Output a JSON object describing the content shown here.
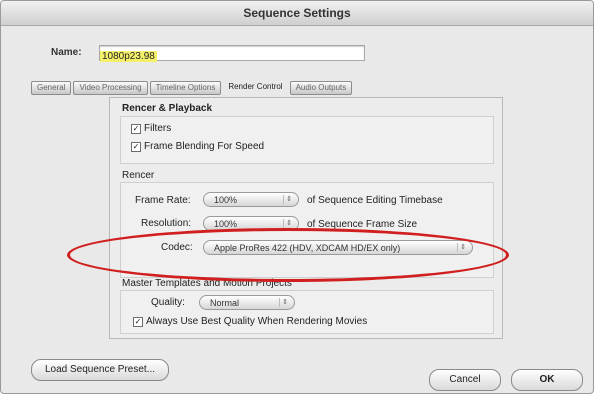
{
  "window": {
    "title": "Sequence Settings"
  },
  "name": {
    "label": "Name:",
    "value": "1080p23.98"
  },
  "tabs": [
    {
      "label": "General"
    },
    {
      "label": "Video Processing"
    },
    {
      "label": "Timeline Options"
    },
    {
      "label": "Render Control"
    },
    {
      "label": "Audio Outputs"
    }
  ],
  "render_playback": {
    "title": "Rencer & Playback",
    "filters_label": "Filters",
    "frame_blending_label": "Frame Blending For Speed"
  },
  "render": {
    "title": "Rencer",
    "frame_rate_label": "Frame Rate:",
    "frame_rate_value": "100%",
    "frame_rate_suffix": "of Sequence Editing Timebase",
    "resolution_label": "Resolution:",
    "resolution_value": "100%",
    "resolution_suffix": "of Sequence Frame Size",
    "codec_label": "Codec:",
    "codec_value": "Apple ProRes 422 (HDV, XDCAM HD/EX only)"
  },
  "master": {
    "title": "Master Templates and Motion Projects",
    "quality_label": "Quality:",
    "quality_value": "Normal",
    "always_label": "Always Use Best Quality When Rendering Movies"
  },
  "buttons": {
    "load_preset": "Load Sequence Preset...",
    "cancel": "Cancel",
    "ok": "OK"
  },
  "colors": {
    "highlight": "#f4f06a",
    "annotation": "#d11f1f"
  },
  "icons": {
    "check": "checkmark-icon",
    "popup": "popup-arrows-icon"
  }
}
